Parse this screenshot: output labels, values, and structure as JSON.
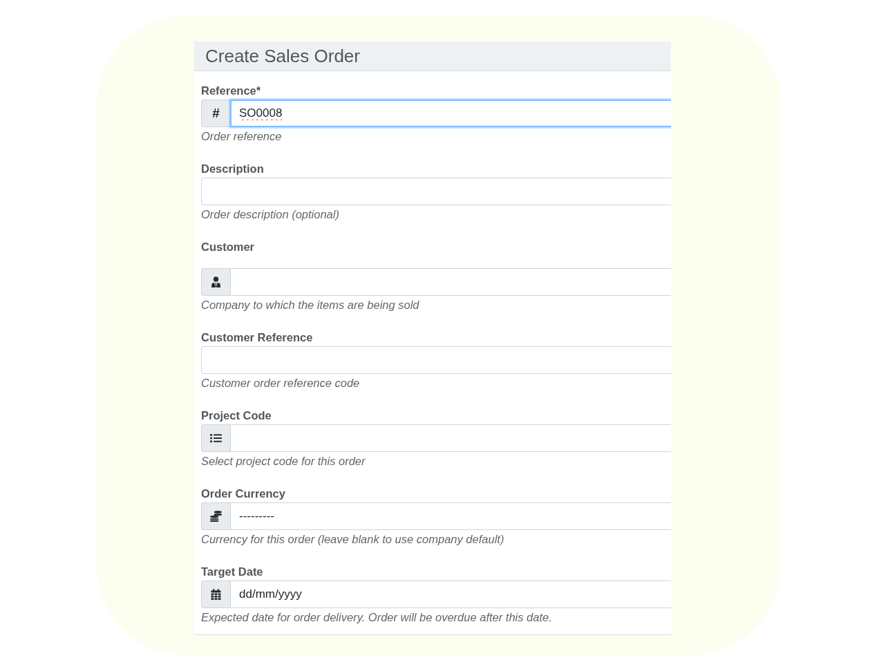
{
  "form": {
    "title": "Create Sales Order",
    "fields": [
      {
        "kind": "reference",
        "label": "Reference*",
        "prefix": "#",
        "value": "SO0008",
        "focused": true,
        "spellcheck_error": true,
        "help": "Order reference"
      },
      {
        "kind": "text",
        "label": "Description",
        "focused": false,
        "help": "Order description (optional)"
      },
      {
        "kind": "customer",
        "label": "Customer",
        "focused": false,
        "help": "Company to which the items are being sold"
      },
      {
        "kind": "text",
        "label": "Customer Reference",
        "focused": false,
        "help": "Customer order reference code"
      },
      {
        "kind": "project",
        "label": "Project Code",
        "focused": false,
        "help": "Select project code for this order"
      },
      {
        "kind": "currency",
        "label": "Order Currency",
        "value": "---------",
        "focused": false,
        "help": "Currency for this order (leave blank to use company default)"
      },
      {
        "kind": "date",
        "label": "Target Date",
        "placeholder": "dd/mm/yyyy",
        "focused": false,
        "help": "Expected date for order delivery. Order will be overdue after this date."
      }
    ]
  }
}
